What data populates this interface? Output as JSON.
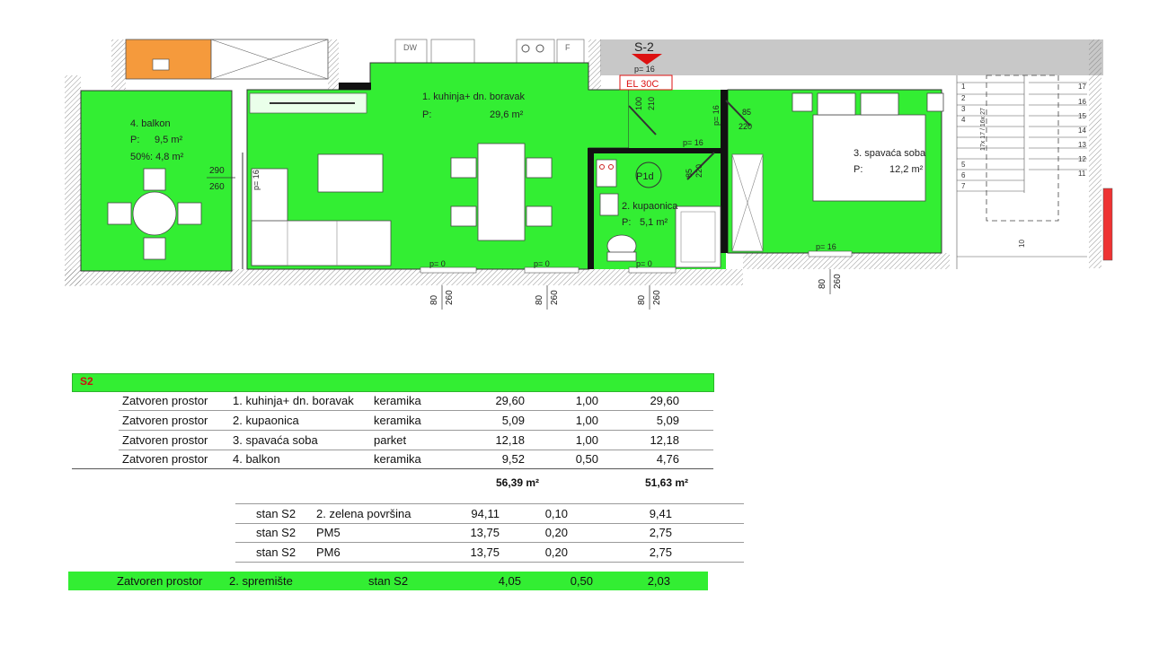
{
  "plan": {
    "unit_label": "S-2",
    "elevation_marker": "EL 30C",
    "appliances": [
      "DW",
      "F"
    ],
    "rooms": [
      {
        "name": "1. kuhinja+ dn. boravak",
        "area": "29,6 m²"
      },
      {
        "name": "2. kupaonica",
        "area": "5,1 m²"
      },
      {
        "name": "3. spavaća soba",
        "area": "12,2 m²"
      },
      {
        "name": "4. balkon",
        "area": "9,5 m²",
        "area_50": "50%: 4,8 m²"
      }
    ],
    "area_prefix": "P:",
    "fixture_label": "P1d",
    "door_dims": [
      {
        "w": "290",
        "h": "260"
      },
      {
        "w": "80",
        "h": "260"
      },
      {
        "w": "80",
        "h": "260"
      },
      {
        "w": "80",
        "h": "260"
      },
      {
        "w": "80",
        "h": "260"
      }
    ],
    "inner_dims": [
      "100",
      "210",
      "85",
      "220",
      "85",
      "220"
    ],
    "sill_labels": [
      "p= 16",
      "p= 16",
      "p= 16",
      "p= 16",
      "p= 0",
      "p= 0",
      "p= 0",
      "p= 16",
      "p= 16"
    ],
    "stair_numbers": [
      "17",
      "16",
      "15",
      "14",
      "13",
      "12",
      "11",
      "1",
      "2",
      "3",
      "4",
      "5",
      "6",
      "7",
      "10"
    ],
    "stair_note": "17x 17 / 16x 27"
  },
  "table": {
    "header": "S2",
    "rows": [
      {
        "type": "Zatvoren prostor",
        "room": "1. kuhinja+ dn. boravak",
        "floor": "keramika",
        "area": "29,60",
        "coef": "1,00",
        "total": "29,60"
      },
      {
        "type": "Zatvoren prostor",
        "room": "2. kupaonica",
        "floor": "keramika",
        "area": "5,09",
        "coef": "1,00",
        "total": "5,09"
      },
      {
        "type": "Zatvoren prostor",
        "room": "3. spavaća soba",
        "floor": "parket",
        "area": "12,18",
        "coef": "1,00",
        "total": "12,18"
      },
      {
        "type": "Zatvoren prostor",
        "room": "4. balkon",
        "floor": "keramika",
        "area": "9,52",
        "coef": "0,50",
        "total": "4,76"
      }
    ],
    "sum_area": "56,39 m²",
    "sum_total": "51,63 m²",
    "extra_rows": [
      {
        "unit": "stan S2",
        "item": "2. zelena površina",
        "area": "94,11",
        "coef": "0,10",
        "total": "9,41"
      },
      {
        "unit": "stan S2",
        "item": "PM5",
        "area": "13,75",
        "coef": "0,20",
        "total": "2,75"
      },
      {
        "unit": "stan S2",
        "item": "PM6",
        "area": "13,75",
        "coef": "0,20",
        "total": "2,75"
      }
    ],
    "storage_row": {
      "type": "Zatvoren prostor",
      "room": "2. spremište",
      "unit": "stan S2",
      "area": "4,05",
      "coef": "0,50",
      "total": "2,03"
    }
  },
  "colors": {
    "room_fill": "#33ee33",
    "wall": "#111111",
    "kitchen_counter": "#f59a3c",
    "neighbor_unit": "#c8c8c8",
    "marker_red": "#dd1111"
  }
}
